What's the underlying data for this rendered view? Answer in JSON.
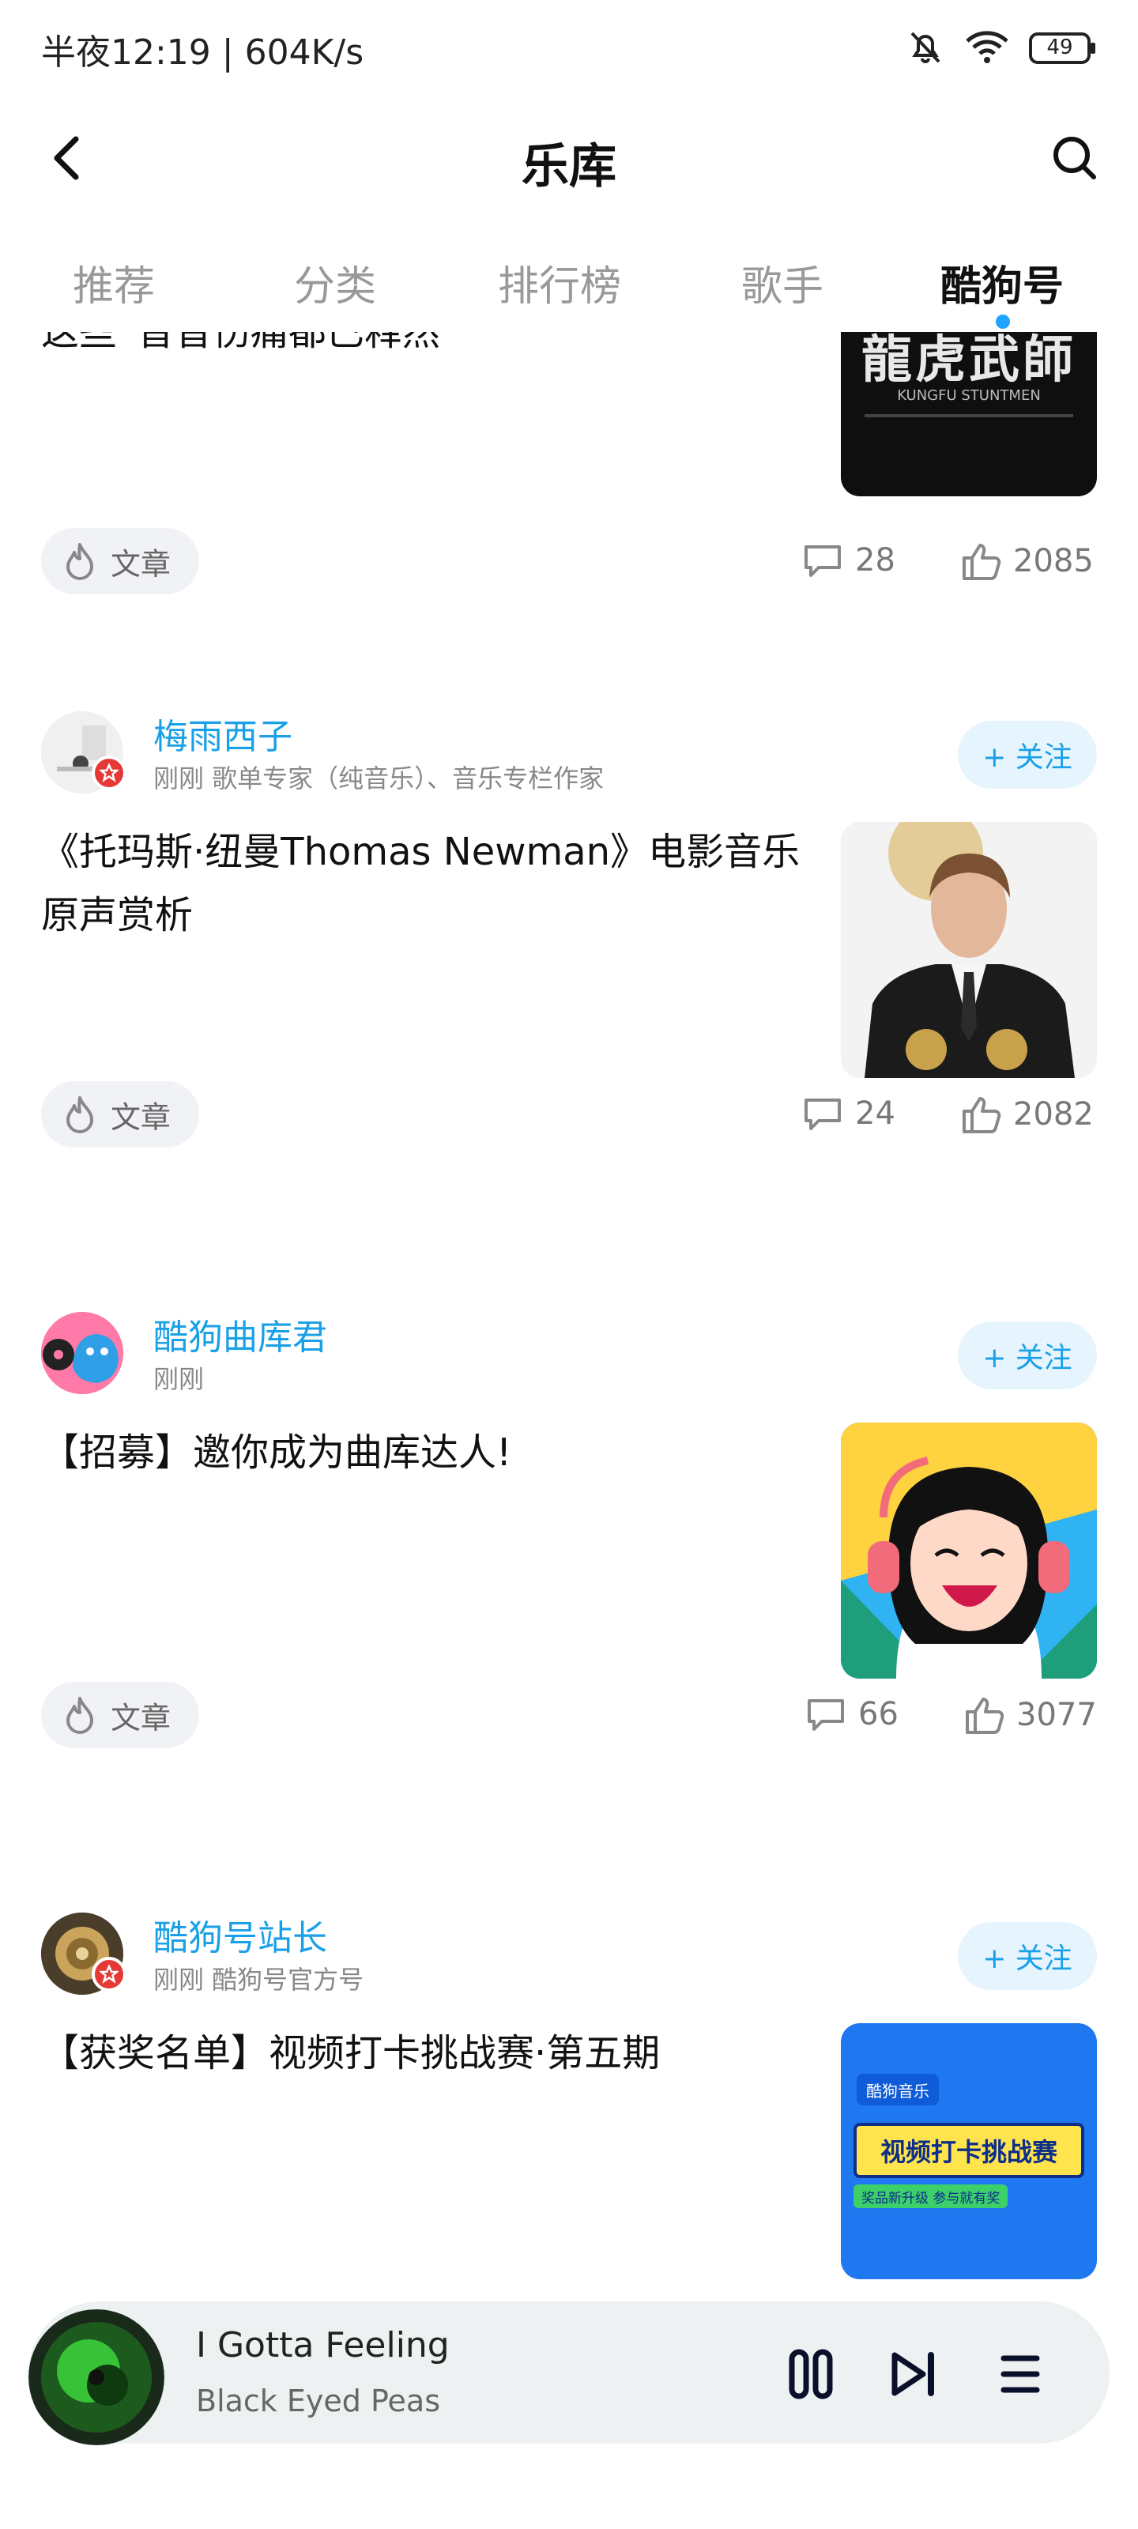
{
  "status": {
    "time_speed": "半夜12:19 | 604K/s",
    "battery": "49"
  },
  "header": {
    "title": "乐库"
  },
  "tabs": [
    {
      "label": "推荐"
    },
    {
      "label": "分类"
    },
    {
      "label": "排行榜"
    },
    {
      "label": "歌手"
    },
    {
      "label": "酷狗号"
    }
  ],
  "partial_card": {
    "title_fragment": "这些“音音伤痛都已释然",
    "thumb_text": "龍虎武師",
    "thumb_subtext": "KUNGFU STUNTMEN",
    "tag": "文章",
    "comments": "28",
    "likes": "2085"
  },
  "cards": [
    {
      "author": "梅雨西子",
      "meta": "刚刚   歌单专家（纯音乐）、音乐专栏作家",
      "follow": "+ 关注",
      "title": "《托玛斯·纽曼Thomas Newman》电影音乐原声赏析",
      "tag": "文章",
      "comments": "24",
      "likes": "2082"
    },
    {
      "author": "酷狗曲库君",
      "meta": "刚刚",
      "follow": "+ 关注",
      "title": "【招募】邀你成为曲库达人!",
      "tag": "文章",
      "comments": "66",
      "likes": "3077"
    },
    {
      "author": "酷狗号站长",
      "meta": "刚刚   酷狗号官方号",
      "follow": "+ 关注",
      "title": "【获奖名单】视频打卡挑战赛·第五期",
      "thumb_brand": "酷狗音乐",
      "thumb_headline": "视频打卡挑战赛",
      "thumb_sub": "奖品新升级 参与就有奖"
    }
  ],
  "player": {
    "title": "I Gotta Feeling",
    "artist": "Black Eyed Peas"
  },
  "colors": {
    "accent": "#1aa0e6",
    "tab_dot": "#1fa3ff",
    "badge": "#e53935"
  }
}
